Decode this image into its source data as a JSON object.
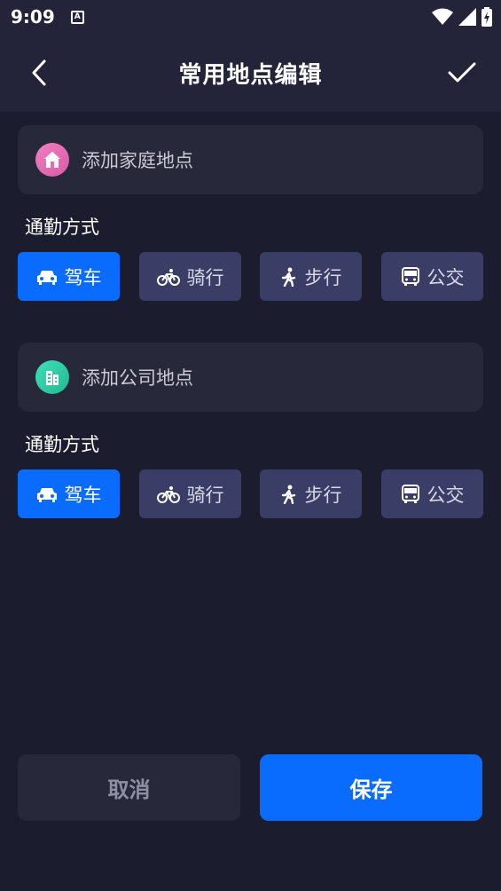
{
  "status_bar": {
    "time": "9:09",
    "a_badge": "A"
  },
  "header": {
    "title": "常用地点编辑"
  },
  "home": {
    "label": "添加家庭地点",
    "section_label": "通勤方式",
    "modes": [
      {
        "label": "驾车",
        "icon": "car-icon",
        "active": true
      },
      {
        "label": "骑行",
        "icon": "bike-icon",
        "active": false
      },
      {
        "label": "步行",
        "icon": "walk-icon",
        "active": false
      },
      {
        "label": "公交",
        "icon": "bus-icon",
        "active": false
      }
    ]
  },
  "company": {
    "label": "添加公司地点",
    "section_label": "通勤方式",
    "modes": [
      {
        "label": "驾车",
        "icon": "car-icon",
        "active": true
      },
      {
        "label": "骑行",
        "icon": "bike-icon",
        "active": false
      },
      {
        "label": "步行",
        "icon": "walk-icon",
        "active": false
      },
      {
        "label": "公交",
        "icon": "bus-icon",
        "active": false
      }
    ]
  },
  "footer": {
    "cancel_label": "取消",
    "save_label": "保存"
  },
  "colors": {
    "accent": "#0a6cff",
    "background": "#1b1c2e",
    "card": "#272839",
    "mode_inactive": "#3a3e66"
  }
}
